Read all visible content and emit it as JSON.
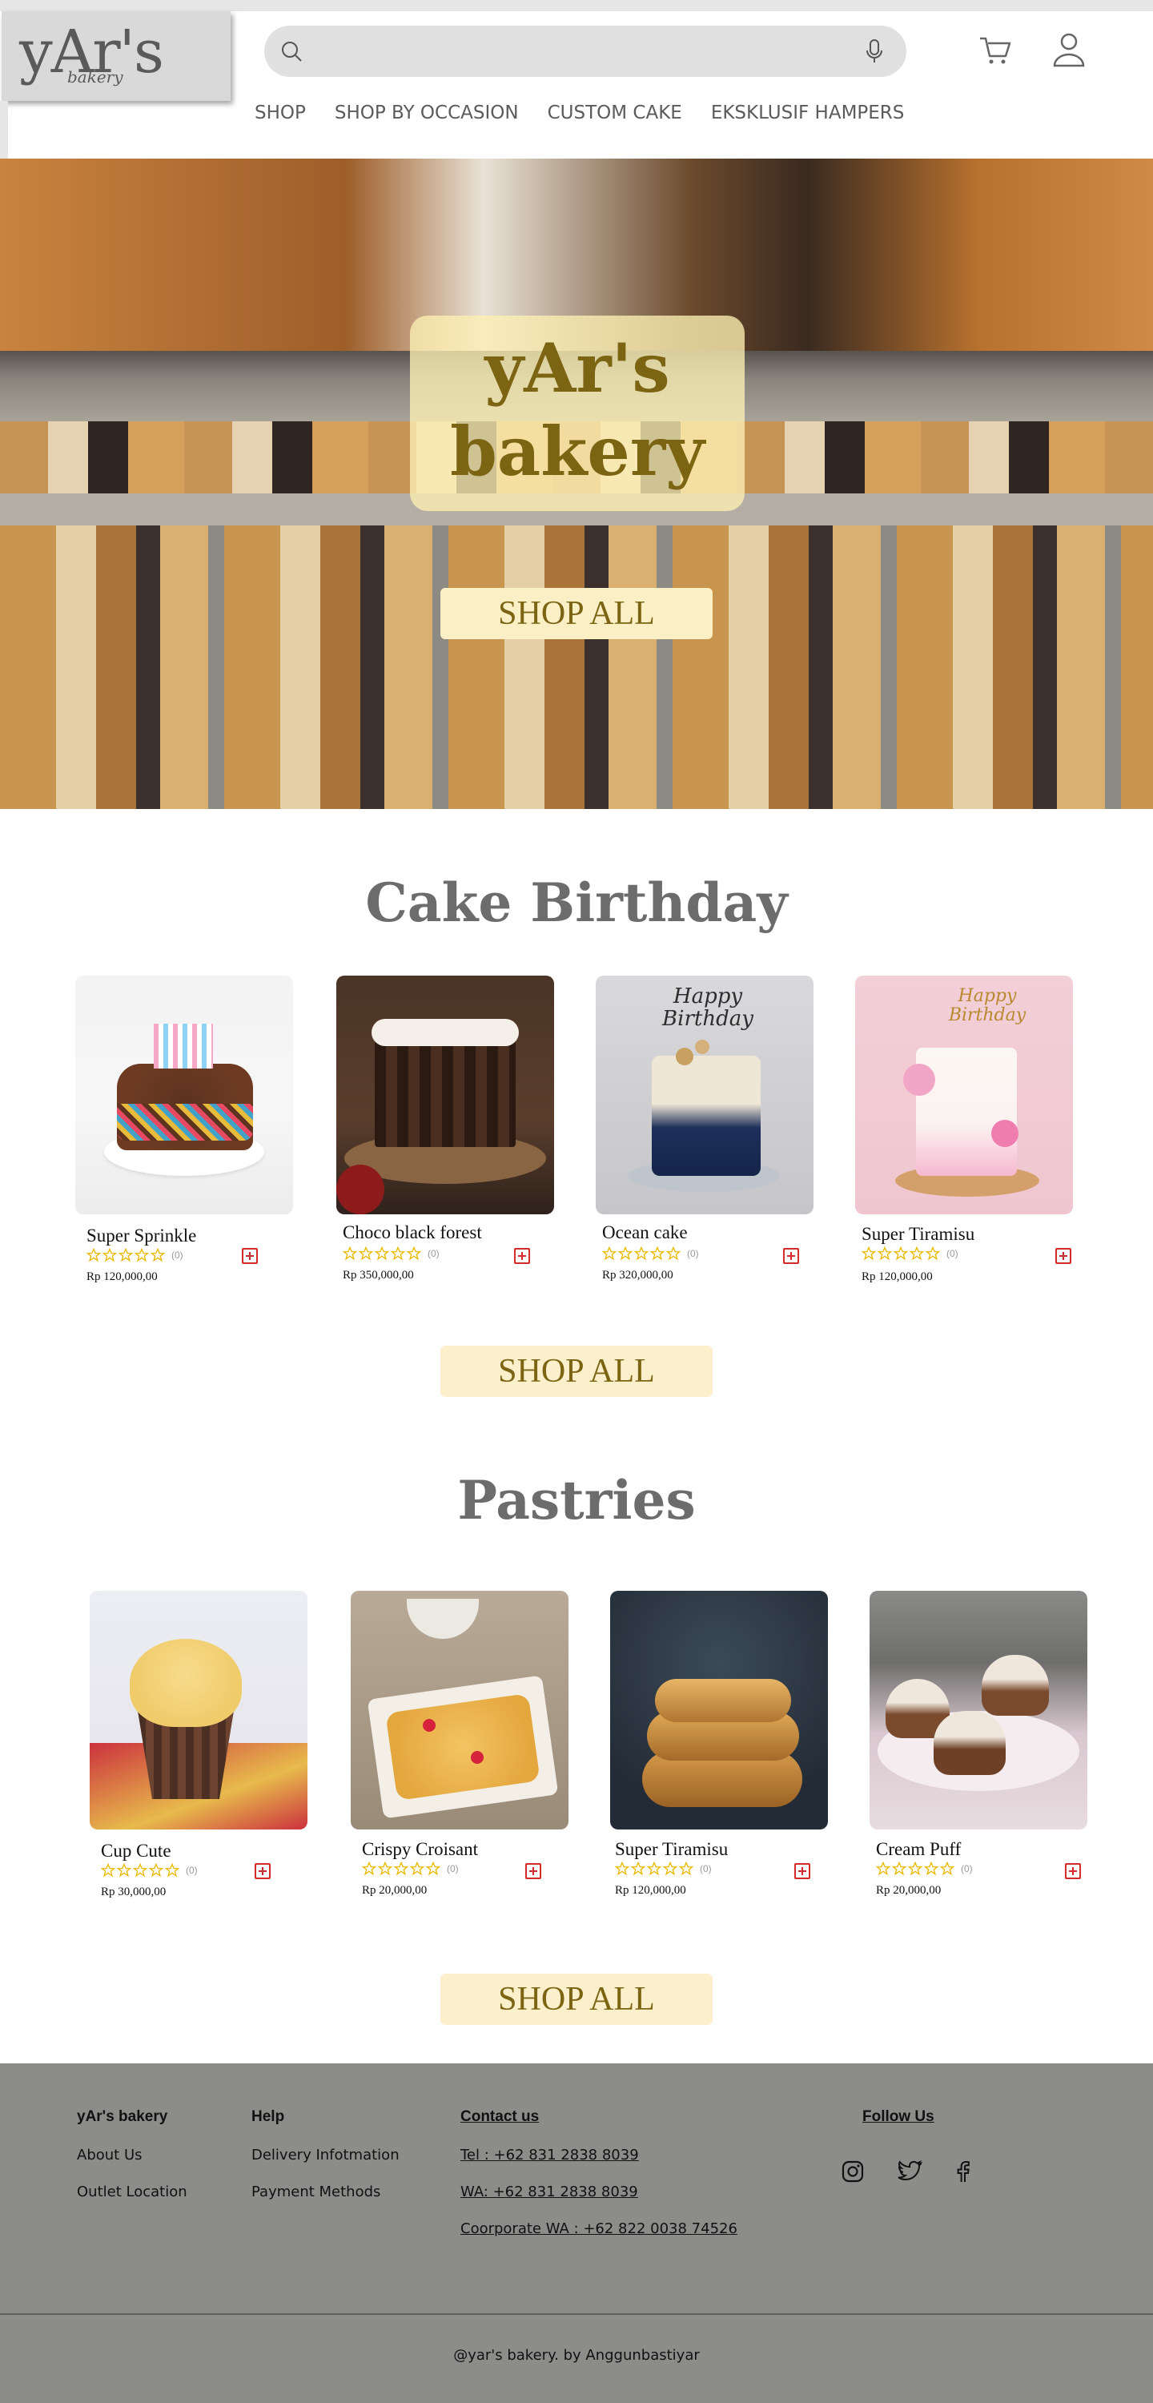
{
  "header": {
    "logo_text": "yAr's",
    "logo_sub": "bakery",
    "search_placeholder": "",
    "nav": [
      "SHOP",
      "SHOP BY OCCASION",
      "CUSTOM CAKE",
      "EKSKLUSIF HAMPERS"
    ]
  },
  "icons": {
    "search": "search-icon",
    "mic": "microphone-icon",
    "cart": "cart-icon",
    "user": "user-icon",
    "star": "star-outline-icon",
    "add": "plus-square-icon",
    "instagram": "instagram-icon",
    "twitter": "twitter-icon",
    "facebook": "facebook-icon"
  },
  "colors": {
    "accent_gold": "#7b6412",
    "button_bg": "#fcf0cc",
    "title_gray": "#6c6c6c",
    "footer_bg": "#8c8c8b",
    "add_red": "#d42a2a",
    "star_yellow": "#e8b800"
  },
  "hero": {
    "title_line1": "yAr's",
    "title_line2": "bakery",
    "cta": "SHOP ALL"
  },
  "birthday": {
    "title": "Cake Birthday",
    "cta": "SHOP ALL",
    "products": [
      {
        "name": "Super Sprinkle",
        "rating_count": "(0)",
        "price": "Rp 120,000,00"
      },
      {
        "name": "Choco black forest",
        "rating_count": "(0)",
        "price": "Rp 350,000,00"
      },
      {
        "name": "Ocean cake",
        "rating_count": "(0)",
        "price": "Rp 320,000,00"
      },
      {
        "name": "Super Tiramisu",
        "rating_count": "(0)",
        "price": "Rp 120,000,00"
      }
    ]
  },
  "pastries": {
    "title": "Pastries",
    "cta": "SHOP ALL",
    "products": [
      {
        "name": "Cup Cute",
        "rating_count": "(0)",
        "price": "Rp 30,000,00"
      },
      {
        "name": "Crispy Croisant",
        "rating_count": "(0)",
        "price": "Rp 20,000,00"
      },
      {
        "name": "Super Tiramisu",
        "rating_count": "(0)",
        "price": "Rp 120,000,00"
      },
      {
        "name": "Cream Puff",
        "rating_count": "(0)",
        "price": "Rp 20,000,00"
      }
    ]
  },
  "cake_images": {
    "c3_topper": "Happy Birthday",
    "c4_topper": "Happy Birthday"
  },
  "footer": {
    "brand": "yAr's bakery",
    "brand_links": [
      "About Us",
      "Outlet Location"
    ],
    "help_title": "Help",
    "help_links": [
      "Delivery Infotmation",
      "Payment Methods"
    ],
    "contact_title": "Contact us",
    "contact_links": [
      "Tel : +62 831 2838 8039",
      "WA: +62 831 2838 8039",
      "Coorporate WA : +62 822 0038 74526"
    ],
    "follow_title": "Follow Us",
    "copyright": "@yar's bakery. by Anggunbastiyar"
  }
}
